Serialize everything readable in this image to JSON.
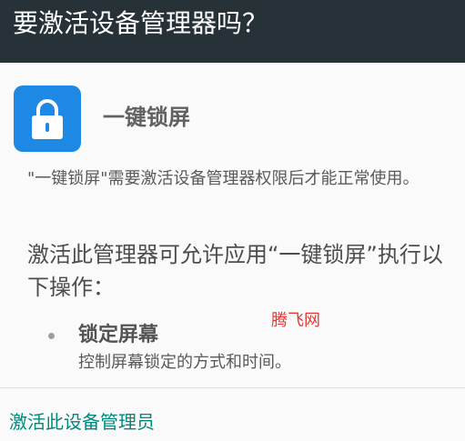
{
  "dialog": {
    "title": "要激活设备管理器吗？"
  },
  "app": {
    "name": "一键锁屏",
    "icon": "lock-icon",
    "icon_bg_color": "#1e88e5",
    "description": "\"一键锁屏\"需要激活设备管理器权限后才能正常使用。"
  },
  "permissions": {
    "intro": "激活此管理器可允许应用“一键锁屏”执行以下操作：",
    "items": [
      {
        "title": "锁定屏幕",
        "description": "控制屏幕锁定的方式和时间。"
      }
    ]
  },
  "watermark": "腾飞网",
  "actions": {
    "activate_label": "激活此设备管理员",
    "accent_color": "#00897b"
  },
  "colors": {
    "titlebar_bg": "#263238",
    "background": "#fafafa"
  }
}
